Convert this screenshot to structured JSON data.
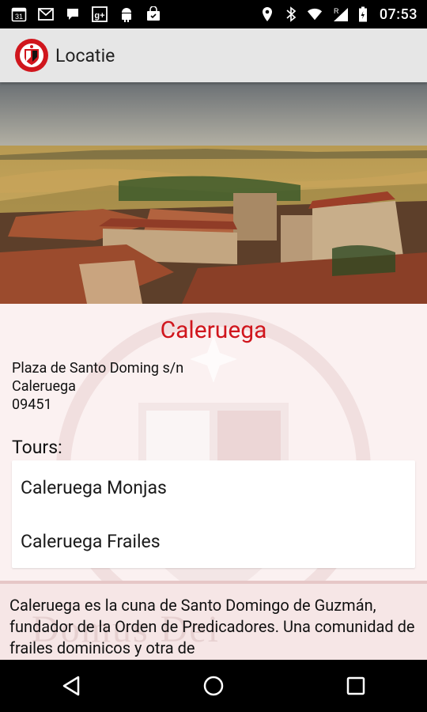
{
  "status_bar": {
    "time": "07:53",
    "left_icons": [
      "calendar-icon",
      "gmail-icon",
      "hangouts-icon",
      "google-plus-icon",
      "android-icon",
      "store-bag-icon"
    ],
    "calendar_day": "31",
    "right_icons": [
      "location-icon",
      "bluetooth-icon",
      "wifi-icon",
      "signal-icon",
      "battery-icon"
    ],
    "signal_indicator": "R"
  },
  "app_bar": {
    "title": "Locatie",
    "logo_icon": "dominican-shield-icon"
  },
  "hero": {
    "icon": "caleruega-panorama-image"
  },
  "location": {
    "name": "Caleruega",
    "address_line1": "Plaza de Santo Doming s/n",
    "address_line2": "Caleruega",
    "postal_code": "09451"
  },
  "tours": {
    "label": "Tours:",
    "items": [
      {
        "label": "Caleruega Monjas"
      },
      {
        "label": "Caleruega Frailes"
      }
    ]
  },
  "description": {
    "text": "Caleruega es la cuna de Santo Domingo de Guzmán, fundador de la Orden de Predicadores. Una comunidad de frailes dominicos y otra de",
    "watermark": "Domus Dei"
  },
  "nav_bar": {
    "icons": [
      "back-icon",
      "home-icon",
      "recents-icon"
    ]
  },
  "colors": {
    "accent": "#d0161d",
    "app_bar": "#e6e6e6",
    "content_bg": "#fbf1f1"
  }
}
